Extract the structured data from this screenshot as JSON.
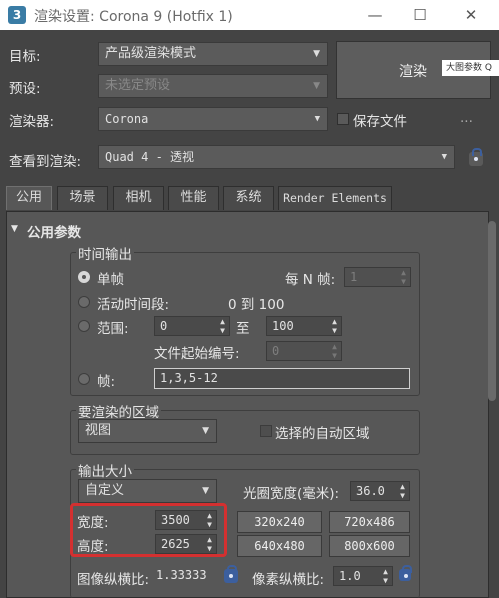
{
  "window": {
    "icon_glyph": "3",
    "title": "渲染设置: Corona 9 (Hotfix 1)",
    "minimize": "—",
    "maximize": "☐",
    "close": "✕"
  },
  "header": {
    "target_label": "目标:",
    "target_value": "产品级渲染模式",
    "preset_label": "预设:",
    "preset_value": "未选定预设",
    "renderer_label": "渲染器:",
    "renderer_value": "Corona",
    "save_file_label": "保存文件",
    "view_label": "查看到渲染:",
    "view_value": "Quad 4 - 透视",
    "render_button": "渲染",
    "more_dots": "...",
    "tooltip": "大图参数 Q"
  },
  "tabs": [
    "公用",
    "场景",
    "相机",
    "性能",
    "系统",
    "Render Elements"
  ],
  "common": {
    "rollout_title": "公用参数",
    "time_output": {
      "title": "时间输出",
      "single_frame": "单帧",
      "every_n_label": "每 N 帧:",
      "every_n_value": "1",
      "active_segment": "活动时间段:",
      "active_range": "0 到 100",
      "range_label": "范围:",
      "range_start": "0",
      "range_to": "至",
      "range_end": "100",
      "file_number_label": "文件起始编号:",
      "file_number_value": "0",
      "frames_label": "帧:",
      "frames_value": "1,3,5-12"
    },
    "area": {
      "title": "要渲染的区域",
      "value": "视图",
      "auto_region": "选择的自动区域"
    },
    "output_size": {
      "title": "输出大小",
      "preset": "自定义",
      "aperture_label": "光圈宽度(毫米):",
      "aperture_value": "36.0",
      "width_label": "宽度:",
      "width_value": "3500",
      "height_label": "高度:",
      "height_value": "2625",
      "presets": [
        "320x240",
        "720x486",
        "640x480",
        "800x600"
      ],
      "image_aspect_label": "图像纵横比:",
      "image_aspect_value": "1.33333",
      "pixel_aspect_label": "像素纵横比:",
      "pixel_aspect_value": "1.0"
    }
  },
  "icons": [
    "app-icon",
    "lock-icon",
    "dropdown-arrow-icon",
    "spinner-arrows-icon",
    "collapse-triangle-icon"
  ]
}
